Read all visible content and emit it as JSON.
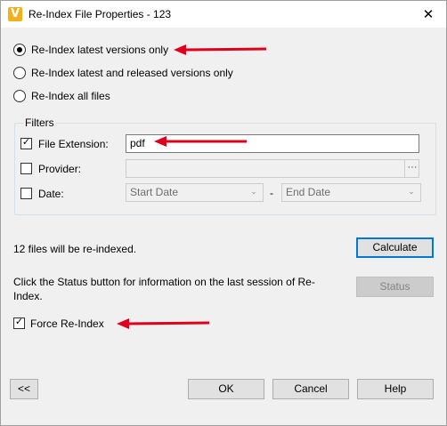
{
  "window": {
    "title": "Re-Index File Properties - 123",
    "app_icon_letter": "V",
    "close_glyph": "✕"
  },
  "scope": {
    "options": [
      {
        "label": "Re-Index latest versions only",
        "selected": true
      },
      {
        "label": "Re-Index latest and released versions only",
        "selected": false
      },
      {
        "label": "Re-Index all files",
        "selected": false
      }
    ]
  },
  "filters": {
    "title": "Filters",
    "file_extension": {
      "label": "File Extension:",
      "checked": true,
      "value": "pdf"
    },
    "provider": {
      "label": "Provider:",
      "checked": false,
      "value": "",
      "browse_label": "···"
    },
    "date": {
      "label": "Date:",
      "checked": false,
      "start_placeholder": "Start Date",
      "separator": "-",
      "end_placeholder": "End Date"
    }
  },
  "calculate": {
    "message": "12 files will be re-indexed.",
    "button_label": "Calculate"
  },
  "status": {
    "message": "Click the Status button for information on the last session of Re-Index.",
    "button_label": "Status"
  },
  "force_reindex": {
    "label": "Force Re-Index",
    "checked": true
  },
  "footer": {
    "collapse_label": "<<",
    "ok_label": "OK",
    "cancel_label": "Cancel",
    "help_label": "Help"
  },
  "annotation_color": "#e0001b",
  "accent_color": "#0078d7"
}
